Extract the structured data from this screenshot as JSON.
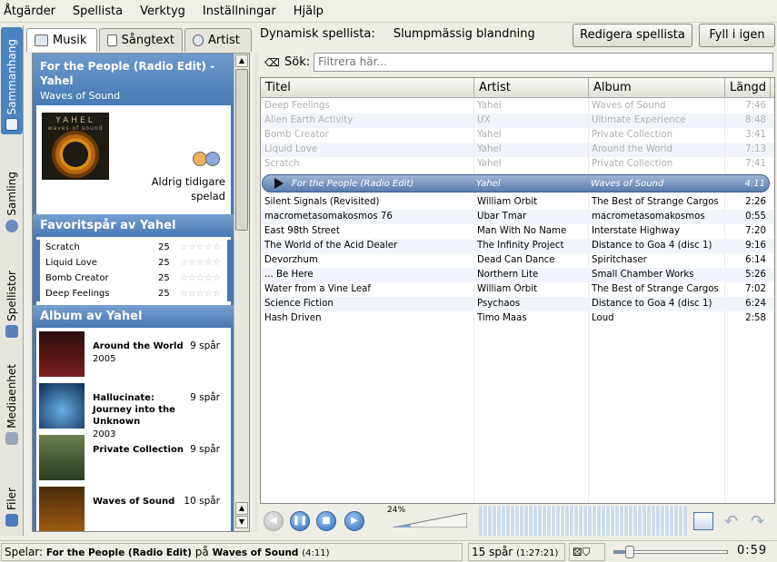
{
  "menu": [
    "Åtgärder",
    "Spellista",
    "Verktyg",
    "Inställningar",
    "Hjälp"
  ],
  "side_tabs": [
    "Sammanhang",
    "Samling",
    "Spellistor",
    "Mediaenhet",
    "Filer"
  ],
  "panel_tabs": [
    "Musik",
    "Sångtext",
    "Artist"
  ],
  "context": {
    "title": "For the People (Radio Edit) - Yahel",
    "artist": "Waves of Sound",
    "cover_text": "YAHEL",
    "cover_sub": "waves of sound",
    "never_played": "Aldrig tidigare spelad",
    "fav_header": "Favoritspår av Yahel",
    "favorites": [
      {
        "name": "Scratch",
        "count": "25",
        "stars": "☆☆☆☆☆"
      },
      {
        "name": "Liquid Love",
        "count": "25",
        "stars": "☆☆☆☆☆"
      },
      {
        "name": "Bomb Creator",
        "count": "25",
        "stars": "☆☆☆☆☆"
      },
      {
        "name": "Deep Feelings",
        "count": "25",
        "stars": "☆☆☆☆☆"
      }
    ],
    "albums_header": "Album av Yahel",
    "albums": [
      {
        "name": "Around the World",
        "year": "2005",
        "tracks": "9 spår"
      },
      {
        "name": "Hallucinate: Journey into the Unknown",
        "year": "2003",
        "tracks": "9 spår"
      },
      {
        "name": "Private Collection",
        "year": "",
        "tracks": "9 spår"
      },
      {
        "name": "Waves of Sound",
        "year": "",
        "tracks": "10 spår"
      }
    ]
  },
  "playlist_info": {
    "label": "Dynamisk spellista:",
    "value": "Slumpmässig blandning",
    "edit_button": "Redigera spellista",
    "refill_button": "Fyll i igen"
  },
  "search": {
    "label": "Sök:",
    "placeholder": "Filtrera här..."
  },
  "columns": [
    "Titel",
    "Artist",
    "Album",
    "Längd"
  ],
  "played": [
    [
      "Deep Feelings",
      "Yahel",
      "Waves of Sound",
      "7:46"
    ],
    [
      "Alien Earth Activity",
      "UX",
      "Ultimate Experience",
      "8:48"
    ],
    [
      "Bomb Creator",
      "Yahel",
      "Private Collection",
      "3:41"
    ],
    [
      "Liquid Love",
      "Yahel",
      "Around the World",
      "7:13"
    ],
    [
      "Scratch",
      "Yahel",
      "Private Collection",
      "7:41"
    ]
  ],
  "current": [
    "For the People (Radio Edit)",
    "Yahel",
    "Waves of Sound",
    "4:11"
  ],
  "upcoming": [
    [
      "Silent Signals (Revisited)",
      "William Orbit",
      "The Best of Strange Cargos",
      "2:26"
    ],
    [
      "macrometasomakosmos 76",
      "Ubar Tmar",
      "macrometasomakosmos",
      "0:55"
    ],
    [
      "East 98th Street",
      "Man With No Name",
      "Interstate Highway",
      "7:20"
    ],
    [
      "The World of the Acid Dealer",
      "The Infinity Project",
      "Distance to Goa 4 (disc 1)",
      "9:16"
    ],
    [
      "Devorzhum",
      "Dead Can Dance",
      "Spiritchaser",
      "6:14"
    ],
    [
      "... Be Here",
      "Northern Lite",
      "Small Chamber Works",
      "5:26"
    ],
    [
      "Water from a Vine Leaf",
      "William Orbit",
      "The Best of Strange Cargos",
      "7:02"
    ],
    [
      "Science Fiction",
      "Psychaos",
      "Distance to Goa 4 (disc 1)",
      "6:24"
    ],
    [
      "Hash Driven",
      "Timo Maas",
      "Loud",
      "2:58"
    ]
  ],
  "volume": {
    "label": "24%",
    "level": 0.24
  },
  "progress": {
    "fraction": 0.14
  },
  "status": {
    "prefix": "Spelar:",
    "track": "For the People (Radio Edit)",
    "on": "på",
    "album": "Waves of Sound",
    "duration": "(4:11)",
    "count": "15 spår",
    "total": "(1:27:21)",
    "time": "0:59"
  },
  "colors": {
    "accent": "#4a78b5",
    "header": "#5b86be",
    "now_playing": "#7a9ccb"
  }
}
